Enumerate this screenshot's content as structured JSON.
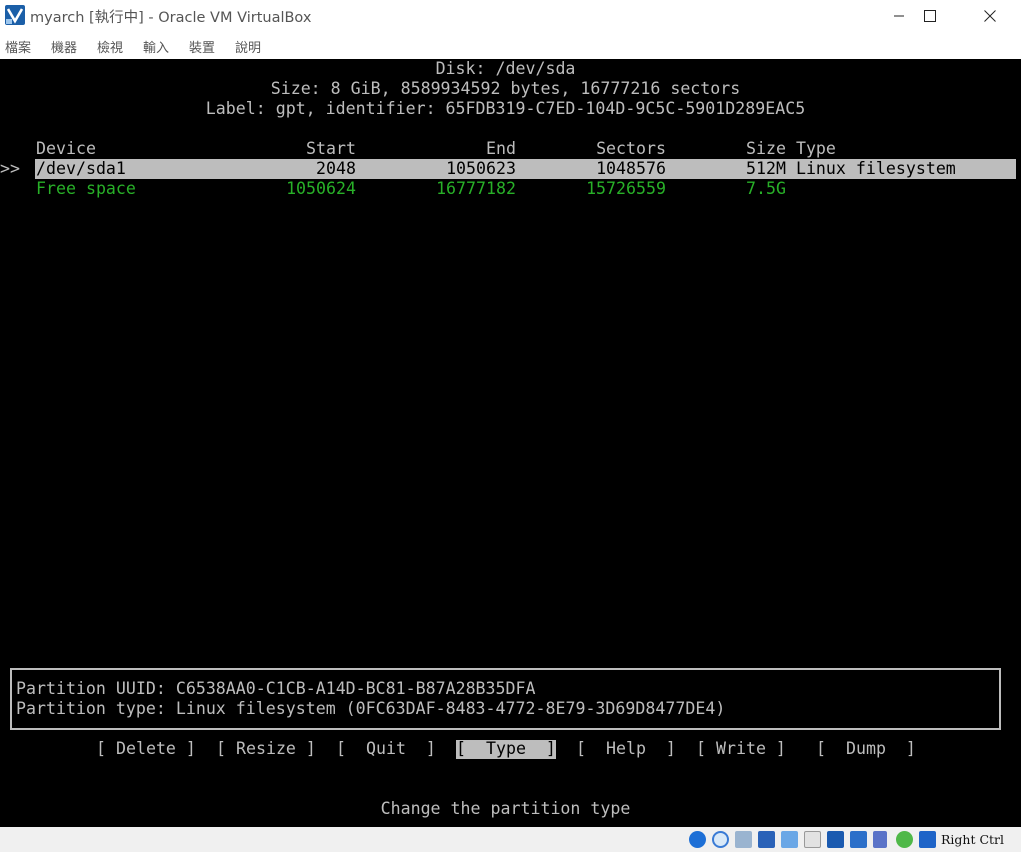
{
  "window": {
    "title": "myarch [執行中] - Oracle VM VirtualBox",
    "icon": "virtualbox-icon"
  },
  "menu": [
    "檔案",
    "機器",
    "檢視",
    "輸入",
    "裝置",
    "說明"
  ],
  "disk": {
    "header": "Disk: /dev/sda",
    "size_line": "Size: 8 GiB, 8589934592 bytes, 16777216 sectors",
    "label_line": "Label: gpt, identifier: 65FDB319-C7ED-104D-9C5C-5901D289EAC5"
  },
  "table": {
    "columns": {
      "device": "Device",
      "start": "Start",
      "end": "End",
      "sectors": "Sectors",
      "size_type": "Size Type"
    },
    "cursor": ">>",
    "rows": [
      {
        "device": "/dev/sda1",
        "start": "2048",
        "end": "1050623",
        "sectors": "1048576",
        "size_type": "512M Linux filesystem",
        "selected": true
      },
      {
        "device": "Free space",
        "start": "1050624",
        "end": "16777182",
        "sectors": "15726559",
        "size_type": "7.5G",
        "selected": false
      }
    ]
  },
  "info": {
    "uuid_line": "Partition UUID: C6538AA0-C1CB-A14D-BC81-B87A28B35DFA",
    "type_line": "Partition type: Linux filesystem (0FC63DAF-8483-4772-8E79-3D69D8477DE4)"
  },
  "actions": {
    "delete": "[ Delete ]",
    "resize": "[ Resize ]",
    "quit": "[  Quit  ]",
    "type": "[  Type  ]",
    "help": "[  Help  ]",
    "write": "[ Write ]",
    "dump": "[  Dump  ]",
    "selected": "type"
  },
  "hint": "Change the partition type",
  "statusbar": {
    "host_key": "Right Ctrl",
    "icons": [
      "hard-disk-icon",
      "optical-drive-icon",
      "audio-icon",
      "network-icon",
      "usb-icon",
      "shared-folders-icon",
      "display-icon",
      "recording-icon",
      "cpu-icon",
      "mouse-integration-icon",
      "keyboard-capture-icon"
    ]
  },
  "colors": {
    "terminal_bg": "#000000",
    "terminal_fg": "#bdbdbd",
    "free_space": "#28b028",
    "selection": "#bdbdbd"
  }
}
